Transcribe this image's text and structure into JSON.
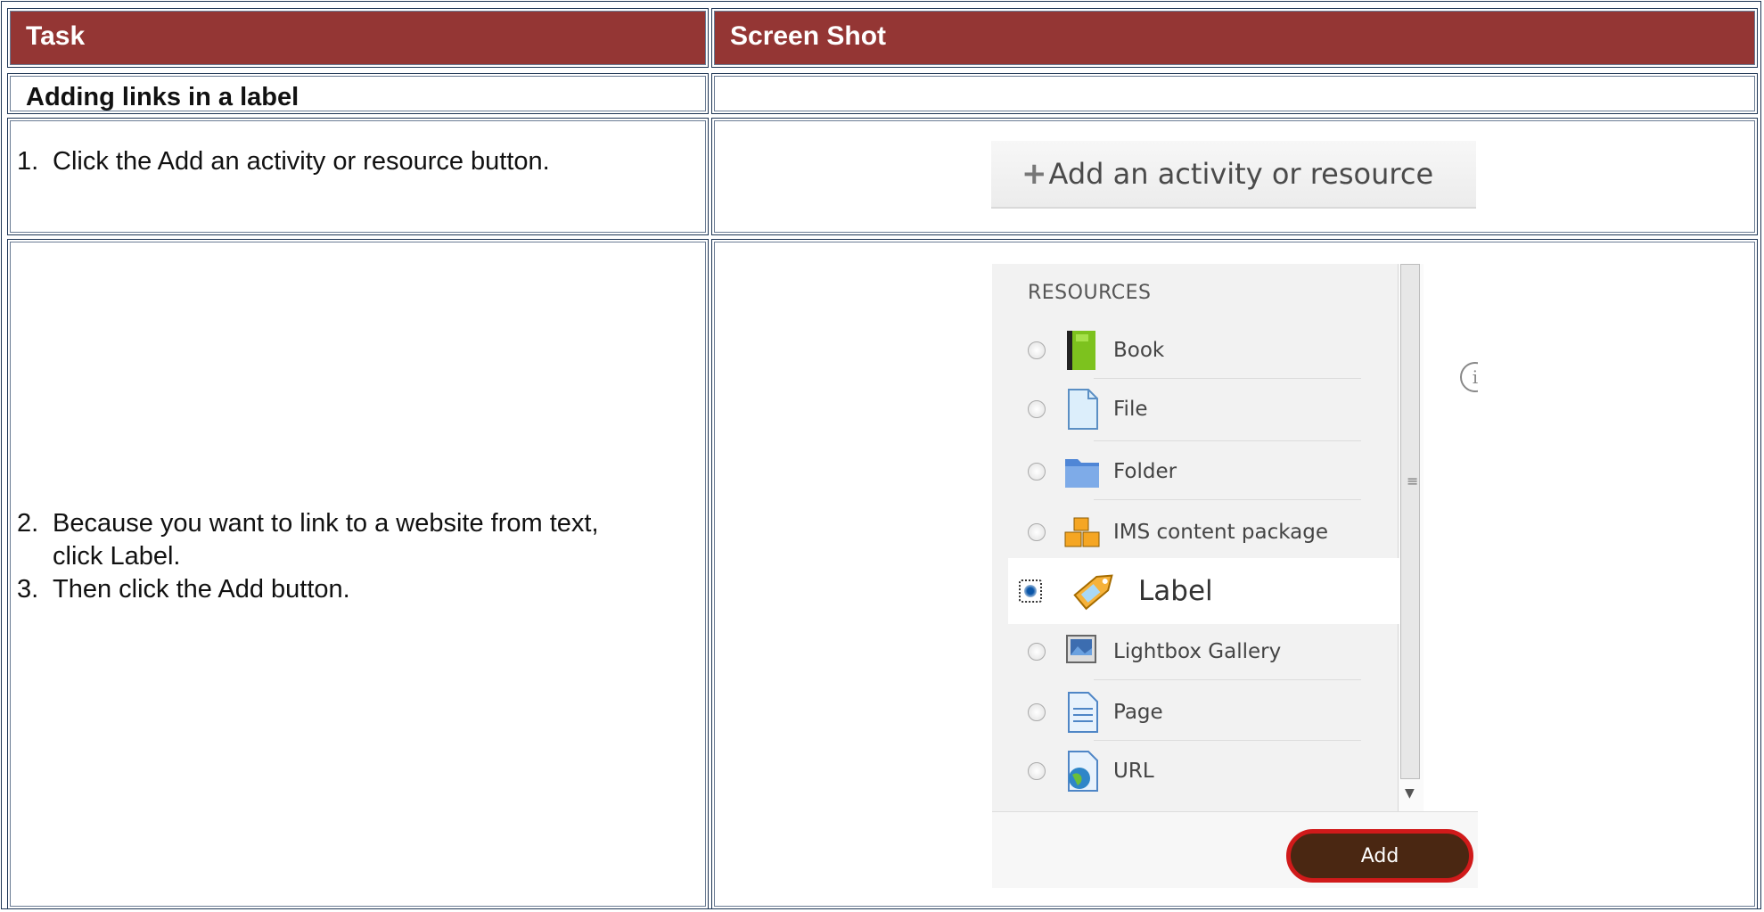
{
  "table": {
    "headers": {
      "task": "Task",
      "screenshot": "Screen Shot"
    },
    "section_title": "Adding links in a label",
    "steps": [
      {
        "number": "1.",
        "text": "Click the Add an activity or resource button."
      },
      {
        "number": "2.",
        "text": "Because you want to link to a website from text, click Label."
      },
      {
        "number": "3.",
        "text": "Then click the Add button."
      }
    ]
  },
  "add_activity_button": {
    "label": "Add an activity or resource"
  },
  "chooser": {
    "section_heading": "RESOURCES",
    "items": [
      {
        "label": "Book",
        "icon": "book-icon"
      },
      {
        "label": "File",
        "icon": "file-icon"
      },
      {
        "label": "Folder",
        "icon": "folder-icon"
      },
      {
        "label": "IMS content package",
        "icon": "package-icon"
      },
      {
        "label": "Label",
        "icon": "label-tag-icon",
        "selected": true
      },
      {
        "label": "Lightbox Gallery",
        "icon": "gallery-icon"
      },
      {
        "label": "Page",
        "icon": "page-icon"
      },
      {
        "label": "URL",
        "icon": "url-globe-icon"
      }
    ],
    "add_button": "Add"
  },
  "colors": {
    "header_bg": "#943634",
    "border": "#1e3554",
    "highlight": "#d01a1a"
  }
}
